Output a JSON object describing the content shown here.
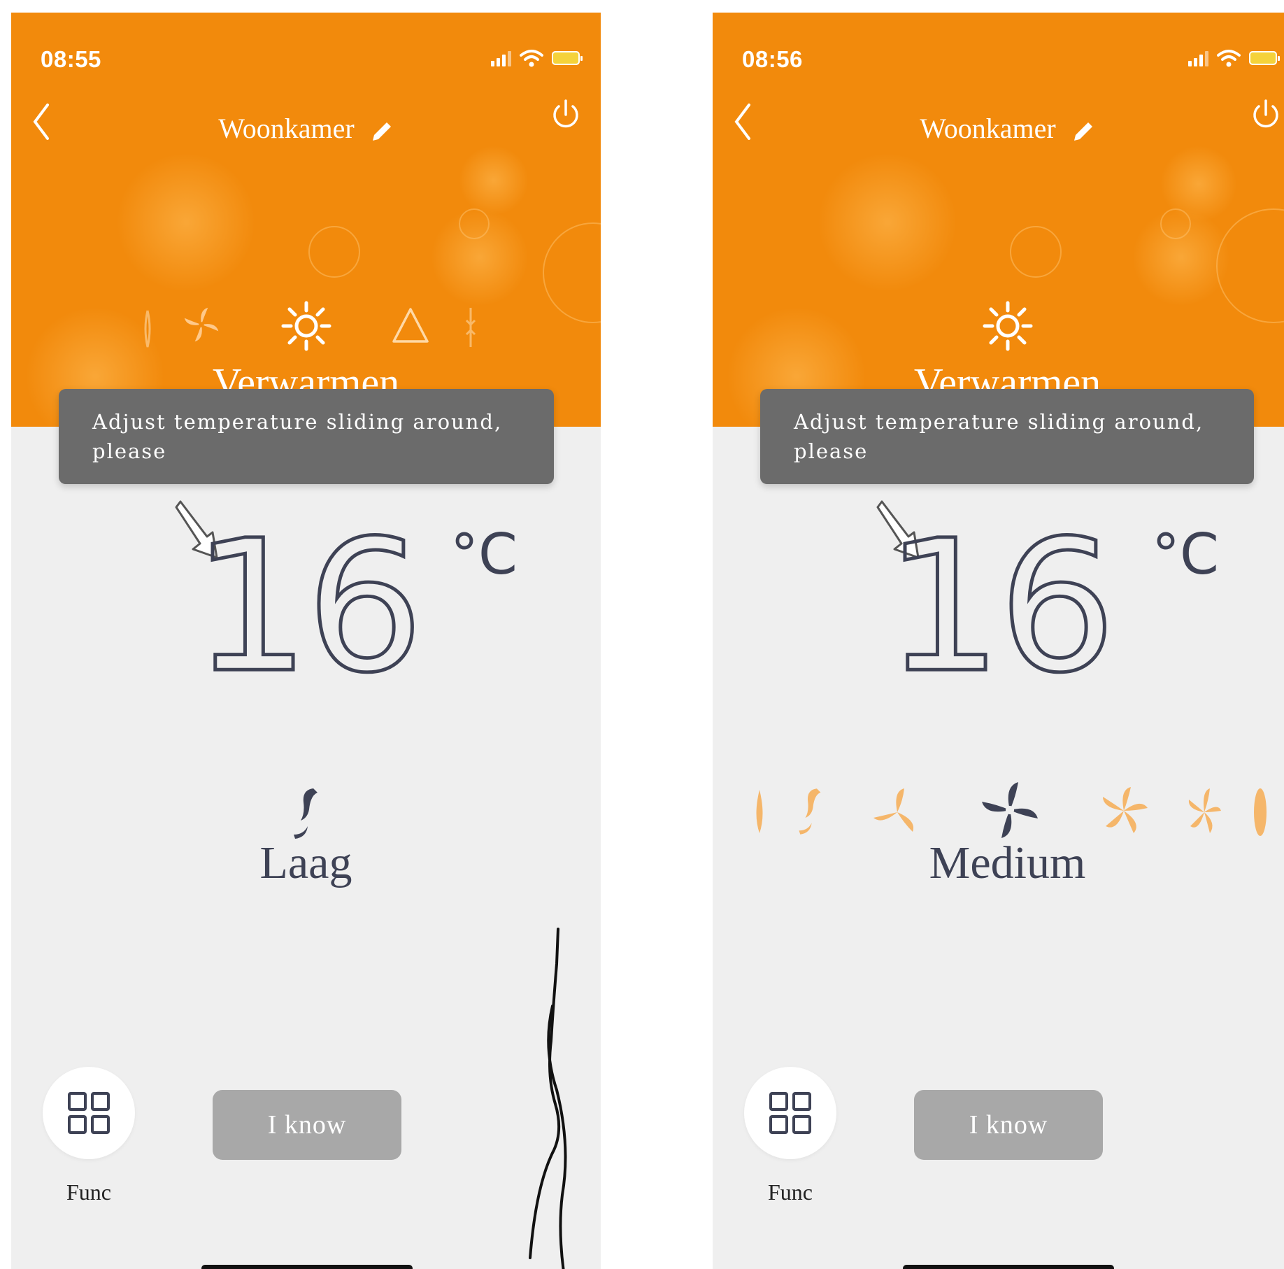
{
  "colors": {
    "header_orange": "#f28a0c",
    "tooltip_gray": "#6b6b6b",
    "button_gray": "#a8a8a8",
    "text_dark": "#3e4255",
    "fan_inactive": "#f5b66a"
  },
  "screens": [
    {
      "status": {
        "time": "08:55"
      },
      "header": {
        "title": "Woonkamer"
      },
      "mode": {
        "label": "Verwarmen",
        "icons": [
          "dry-icon",
          "fan-mode-icon",
          "sun-icon",
          "auto-icon",
          "snow-icon"
        ]
      },
      "tooltip": {
        "text": "Adjust temperature sliding around, please"
      },
      "temperature": {
        "value": "16",
        "unit": "°C"
      },
      "fan": {
        "label": "Laag"
      },
      "func": {
        "label": "Func"
      },
      "confirm": {
        "label": "I know"
      }
    },
    {
      "status": {
        "time": "08:56"
      },
      "header": {
        "title": "Woonkamer"
      },
      "mode": {
        "label": "Verwarmen",
        "icons": [
          "sun-icon"
        ]
      },
      "tooltip": {
        "text": "Adjust temperature sliding around, please"
      },
      "temperature": {
        "value": "16",
        "unit": "°C"
      },
      "fan": {
        "label": "Medium",
        "speeds": [
          "auto",
          "silent",
          "low",
          "medium",
          "high",
          "turbo",
          "max"
        ]
      },
      "func": {
        "label": "Func"
      },
      "confirm": {
        "label": "I know"
      }
    }
  ]
}
